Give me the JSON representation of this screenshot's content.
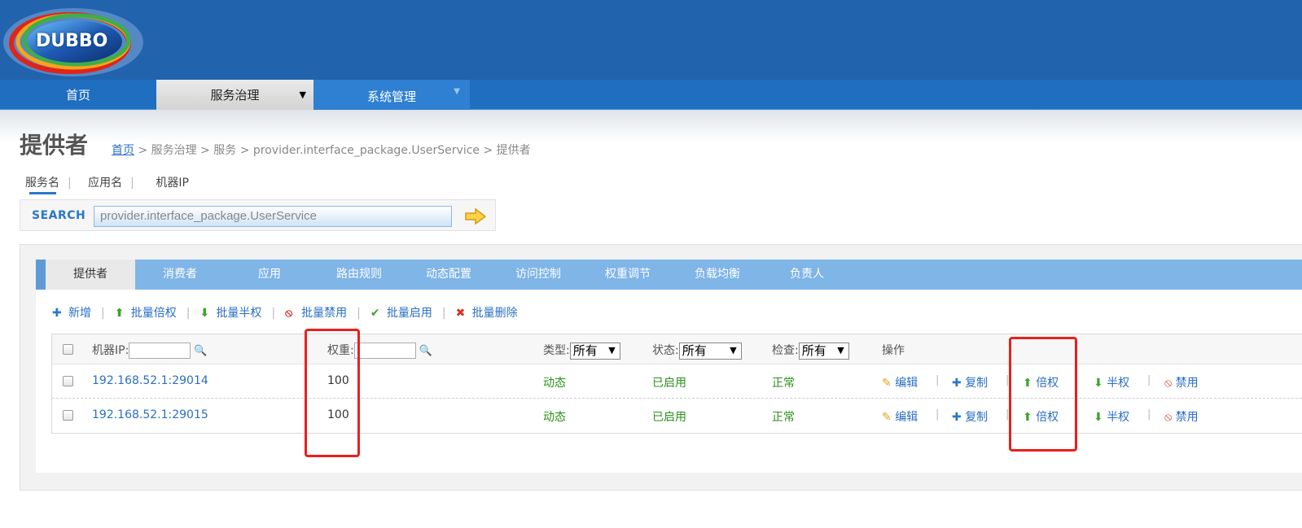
{
  "brand": {
    "logo_text": "DUBBO"
  },
  "nav": {
    "items": [
      {
        "label": "首页"
      },
      {
        "label": "服务治理"
      },
      {
        "label": "系统管理"
      }
    ]
  },
  "page": {
    "title": "提供者",
    "breadcrumb": {
      "home": "首页",
      "rest": " > 服务治理 > 服务 > provider.interface_package.UserService > 提供者"
    }
  },
  "search": {
    "tabs": [
      "服务名",
      "应用名",
      "机器IP"
    ],
    "label": "SEARCH",
    "value": "provider.interface_package.UserService"
  },
  "tabs": [
    "提供者",
    "消费者",
    "应用",
    "路由规则",
    "动态配置",
    "访问控制",
    "权重调节",
    "负载均衡",
    "负责人"
  ],
  "actions": [
    {
      "label": "新增",
      "icon": "plus-icon"
    },
    {
      "label": "批量倍权",
      "icon": "arrow-up-icon"
    },
    {
      "label": "批量半权",
      "icon": "arrow-down-icon"
    },
    {
      "label": "批量禁用",
      "icon": "ban-icon"
    },
    {
      "label": "批量启用",
      "icon": "check-icon"
    },
    {
      "label": "批量删除",
      "icon": "cross-icon"
    }
  ],
  "table": {
    "headers": {
      "ip": "机器IP:",
      "weight": "权重:",
      "type": "类型:",
      "status": "状态:",
      "check": "检查:",
      "ops": "操作"
    },
    "filter_select": {
      "type": "所有",
      "status": "所有",
      "check": "所有"
    },
    "rows": [
      {
        "ip": "192.168.52.1:29014",
        "weight": "100",
        "type": "动态",
        "status": "已启用",
        "check": "正常"
      },
      {
        "ip": "192.168.52.1:29015",
        "weight": "100",
        "type": "动态",
        "status": "已启用",
        "check": "正常"
      }
    ],
    "ops": {
      "edit": "编辑",
      "copy": "复制",
      "double": "倍权",
      "half": "半权",
      "disable": "禁用"
    }
  },
  "colors": {
    "header_bg": "#2163ad",
    "nav_bg": "#1f6ec0",
    "tabbar_bg": "#7fb5e7",
    "link": "#2a6fc4",
    "ok_green": "#2c8f1b",
    "highlight": "#e8201c"
  }
}
